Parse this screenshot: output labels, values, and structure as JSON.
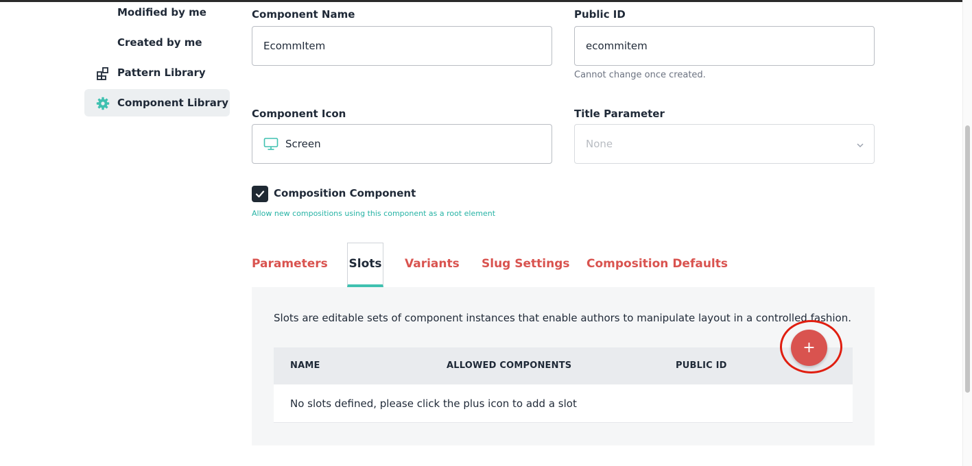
{
  "sidebar": {
    "items": [
      {
        "label": "Modified by me",
        "icon": ""
      },
      {
        "label": "Created by me",
        "icon": ""
      },
      {
        "label": "Pattern Library",
        "icon": "pattern-grid-icon"
      },
      {
        "label": "Component Library",
        "icon": "gear-icon",
        "active": true
      }
    ]
  },
  "form": {
    "component_name": {
      "label": "Component Name",
      "value": "EcommItem"
    },
    "public_id": {
      "label": "Public ID",
      "value": "ecommitem",
      "hint": "Cannot change once created."
    },
    "component_icon": {
      "label": "Component Icon",
      "value": "Screen",
      "icon": "monitor-icon"
    },
    "title_parameter": {
      "label": "Title Parameter",
      "value": "None"
    },
    "composition": {
      "label": "Composition Component",
      "checked": true,
      "hint": "Allow new compositions using this component as a root element"
    }
  },
  "tabs": [
    {
      "label": "Parameters"
    },
    {
      "label": "Slots",
      "active": true
    },
    {
      "label": "Variants"
    },
    {
      "label": "Slug Settings"
    },
    {
      "label": "Composition Defaults"
    }
  ],
  "slots_panel": {
    "description": "Slots are editable sets of component instances that enable authors to manipulate layout in a controlled fashion.",
    "add_button": "+",
    "columns": [
      "NAME",
      "ALLOWED COMPONENTS",
      "PUBLIC ID"
    ],
    "empty_message": "No slots defined, please click the plus icon to add a slot"
  },
  "colors": {
    "accent_red": "#d9534f",
    "accent_teal": "#3fc1b0",
    "highlight": "#e01e10"
  }
}
